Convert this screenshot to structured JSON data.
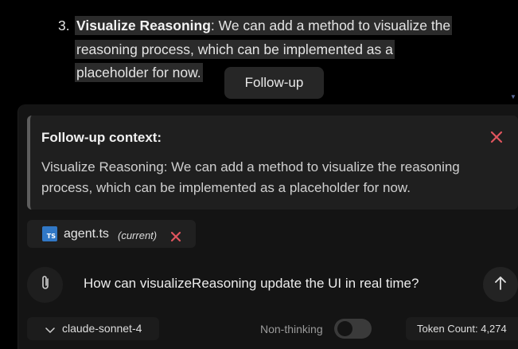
{
  "message": {
    "list_number": "3.",
    "item_bold": "Visualize Reasoning",
    "item_line1": ": We can add a method to visualize the",
    "item_line2": "reasoning process, which can be implemented as a",
    "item_line3": "placeholder for now."
  },
  "selection_popup": {
    "followup_label": "Follow-up"
  },
  "followup_context": {
    "title": "Follow-up context:",
    "body": "Visualize Reasoning: We can add a method to visualize the reasoning process, which can be implemented as a placeholder for now.",
    "close_icon": "close-x-icon",
    "close_color": "#e0555e"
  },
  "attached_file": {
    "icon": "typescript-file-icon",
    "icon_text": "TS",
    "icon_color": "#3178c6",
    "name": "agent.ts",
    "tag": "(current)",
    "remove_icon": "close-x-icon"
  },
  "composer": {
    "attach_icon": "paperclip-icon",
    "input_value": "How can visualizeReasoning update the UI in real time?",
    "send_icon": "arrow-up-icon"
  },
  "footer": {
    "model": "claude-sonnet-4",
    "thinking_label": "Non-thinking",
    "thinking_enabled": false,
    "token_count": "Token Count: 4,274"
  }
}
